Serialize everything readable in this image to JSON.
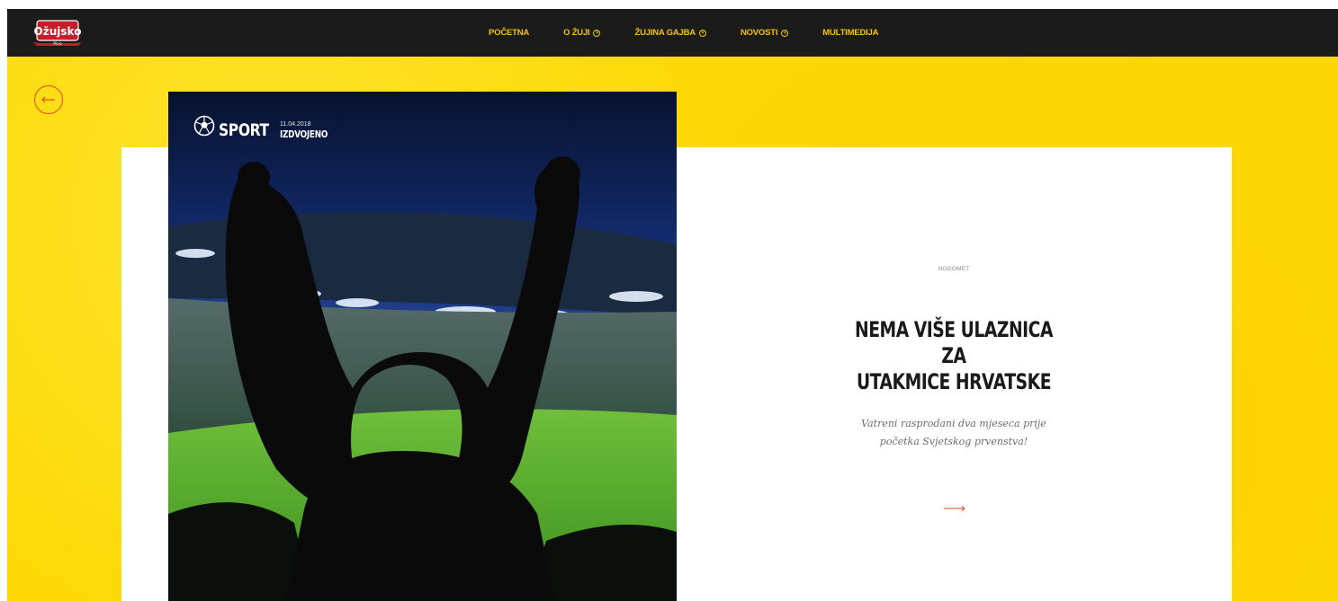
{
  "brand": {
    "logo_text": "Ožujsko",
    "logo_sub": "Pivo",
    "colors": {
      "header": "#1b1b1b",
      "accent": "#f2c500",
      "background": "#fcd804",
      "arrow": "#e84a1b"
    }
  },
  "nav": {
    "items": [
      {
        "label": "POČETNA",
        "has_dropdown": false
      },
      {
        "label": "O ŽUJI",
        "has_dropdown": true
      },
      {
        "label": "ŽUJINA GAJBA",
        "has_dropdown": true
      },
      {
        "label": "NOVOSTI",
        "has_dropdown": true
      },
      {
        "label": "MULTIMEDIJA",
        "has_dropdown": false
      }
    ]
  },
  "back_button": {
    "icon": "arrow-left-icon"
  },
  "hero": {
    "section_label": "SPORT",
    "section_icon": "football-icon",
    "date": "11.04.2018",
    "tag": "IZDVOJENO"
  },
  "article": {
    "category": "NOGOMET",
    "headline_line1": "NEMA VIŠE ULAZNICA ZA",
    "headline_line2": "UTAKMICE HRVATSKE",
    "summary": "Vatreni rasprodani dva mjeseca prije početka Svjetskog prvenstva!",
    "read_more_icon": "arrow-right-icon"
  }
}
